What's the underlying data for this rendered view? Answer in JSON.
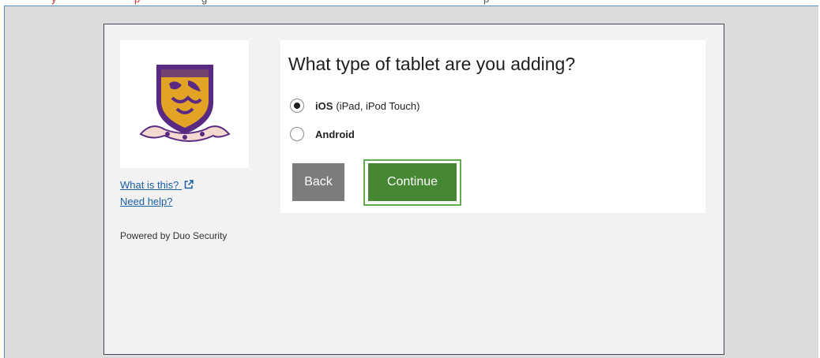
{
  "top_strip_fragments": [
    "y",
    "p",
    "g",
    "p"
  ],
  "sidebar": {
    "what_is_this": "What is this?",
    "need_help": "Need help?",
    "powered_by": "Powered by Duo Security",
    "external_link_icon": "external-link-icon"
  },
  "prompt": {
    "title": "What type of tablet are you adding?",
    "options": [
      {
        "name": "iOS",
        "detail": "(iPad, iPod Touch)",
        "selected": true
      },
      {
        "name": "Android",
        "detail": "",
        "selected": false
      }
    ],
    "back_label": "Back",
    "continue_label": "Continue"
  },
  "colors": {
    "continue": "#468734",
    "focus_ring": "#5fae4d",
    "back": "#7c7c7c",
    "link": "#1a5fa8",
    "logo_purple": "#5a2a82",
    "logo_gold": "#e3a425"
  }
}
